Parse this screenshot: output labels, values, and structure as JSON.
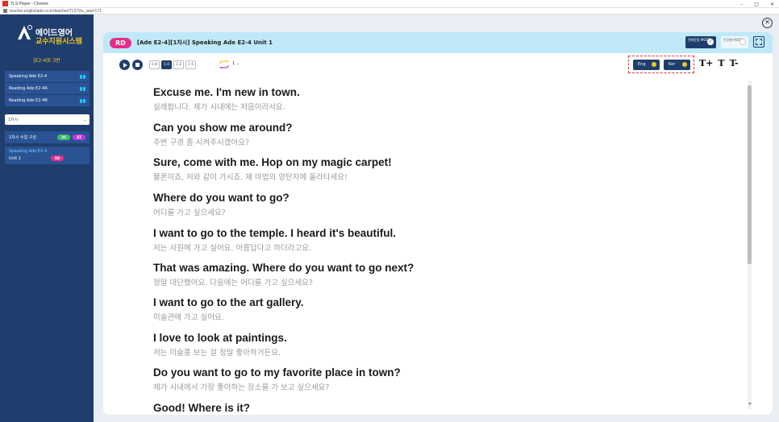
{
  "browser": {
    "title": "TLS Player - Chrome",
    "url": "teacher.englishade.co.kr/teacher/TLS?cls_seq=171",
    "controls": [
      "–",
      "□",
      "✕"
    ]
  },
  "sidebar": {
    "logo_top": "에이드영어",
    "logo_sub": "교수지원시스템",
    "level": "[E2-4]E 3반",
    "items": [
      {
        "label": "Speaking Ade E2-4"
      },
      {
        "label": "Reading Ade E2-4A"
      },
      {
        "label": "Reading Ade E2-4B"
      }
    ],
    "select_value": "1차시",
    "lesson_label": "1차시 수업 구성",
    "lesson_badges": [
      "VC",
      "ST"
    ],
    "active_unit": {
      "line1": "Speaking Ade E2-4",
      "line2": "Unit 1",
      "badge": "RD"
    }
  },
  "header": {
    "badge": "RD",
    "title": "[Ade E2-4][1차시] Speaking Ade E2-4 Unit 1",
    "mode_all": "전체문장 MODE",
    "mode_sentence": "문장별 MODE"
  },
  "toolbar": {
    "speeds": [
      "0.8",
      "1.0",
      "1.2",
      "1.5"
    ],
    "active_speed": "1.0",
    "repeat_value": "1",
    "lang_eng": "Eng",
    "lang_kor": "Kor",
    "font_up": "T+",
    "font_reset": "T",
    "font_down": "T-"
  },
  "sentences": [
    {
      "en": "Excuse me. I'm new in town.",
      "ko": "실례합니다. 제가 시내에는 처음이라서요."
    },
    {
      "en": "Can you show me around?",
      "ko": "주변 구경 좀 시켜주시겠어요?"
    },
    {
      "en": "Sure, come with me. Hop on my magic carpet!",
      "ko": "물론이죠, 저와 같이 가시죠. 제 마법의 양탄자에 올라타세요!"
    },
    {
      "en": "Where do you want to go?",
      "ko": "어디를 가고 싶으세요?"
    },
    {
      "en": "I want to go to the temple. I heard it's beautiful.",
      "ko": "저는 사원에 가고 싶어요. 아름답다고 하더라고요."
    },
    {
      "en": "That was amazing. Where do you want to go next?",
      "ko": "정말 대단했어요. 다음에는 어디를 가고 싶으세요?"
    },
    {
      "en": "I want to go to the art gallery.",
      "ko": "미술관에 가고 싶어요."
    },
    {
      "en": "I love to look at paintings.",
      "ko": "저는 미술품 보는 걸 정말 좋아하거든요."
    },
    {
      "en": "Do you want to go to my favorite place in town?",
      "ko": "제가 시내에서 가장 좋아하는 장소를 가 보고 싶으세요?"
    },
    {
      "en": "Good! Where is it?",
      "ko": ""
    }
  ]
}
